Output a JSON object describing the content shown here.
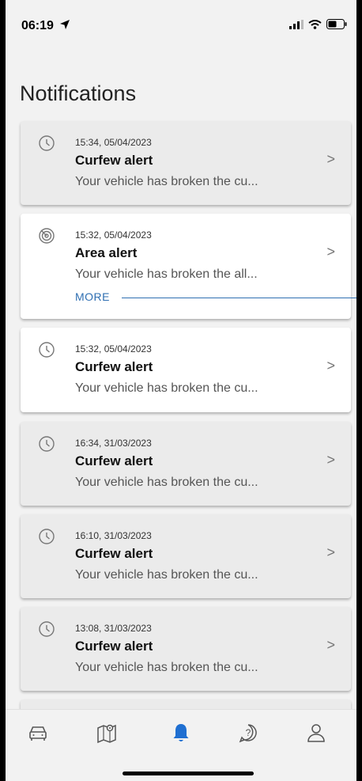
{
  "status": {
    "time": "06:19"
  },
  "title": "Notifications",
  "notifications": [
    {
      "time": "15:34, 05/04/2023",
      "title": "Curfew alert",
      "message": "Your vehicle has broken the cu...",
      "icon": "clock-icon"
    },
    {
      "time": "15:32, 05/04/2023",
      "title": "Area alert",
      "message": "Your vehicle has broken the all...",
      "icon": "target-icon",
      "more_label": "MORE"
    },
    {
      "time": "15:32, 05/04/2023",
      "title": "Curfew alert",
      "message": "Your vehicle has broken the cu...",
      "icon": "clock-icon"
    },
    {
      "time": "16:34, 31/03/2023",
      "title": "Curfew alert",
      "message": "Your vehicle has broken the cu...",
      "icon": "clock-icon"
    },
    {
      "time": "16:10, 31/03/2023",
      "title": "Curfew alert",
      "message": "Your vehicle has broken the cu...",
      "icon": "clock-icon"
    },
    {
      "time": "13:08, 31/03/2023",
      "title": "Curfew alert",
      "message": "Your vehicle has broken the cu...",
      "icon": "clock-icon"
    }
  ],
  "chevron": ">",
  "nav": [
    {
      "icon": "car-icon"
    },
    {
      "icon": "map-pin-icon"
    },
    {
      "icon": "bell-icon",
      "active": true
    },
    {
      "icon": "help-icon"
    },
    {
      "icon": "profile-icon"
    }
  ],
  "colors": {
    "accent": "#1f6fd1",
    "link": "#2f6fb2"
  }
}
